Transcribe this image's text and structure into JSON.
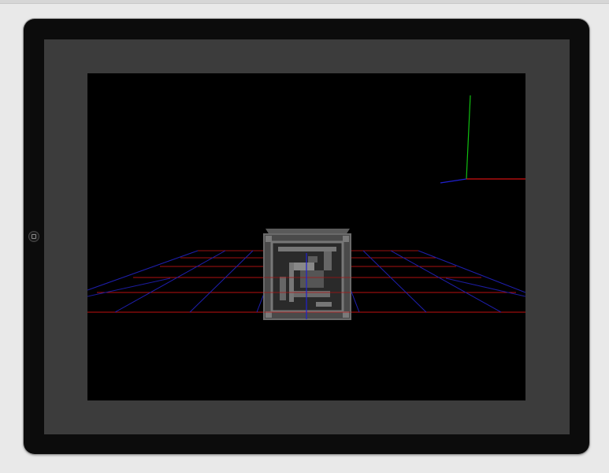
{
  "scene": {
    "background": "#000000",
    "bezel_color": "#0c0c0c",
    "screen_color": "#3c3c3c",
    "grid_red": "#b01010",
    "grid_blue": "#2020c0",
    "axis_x_color": "#d01010",
    "axis_y_color": "#10c010",
    "axis_z_color": "#2020d0"
  },
  "icons": {
    "home": "home-button-icon",
    "cube": "textured-crate-icon",
    "gizmo": "axis-gizmo-icon"
  }
}
